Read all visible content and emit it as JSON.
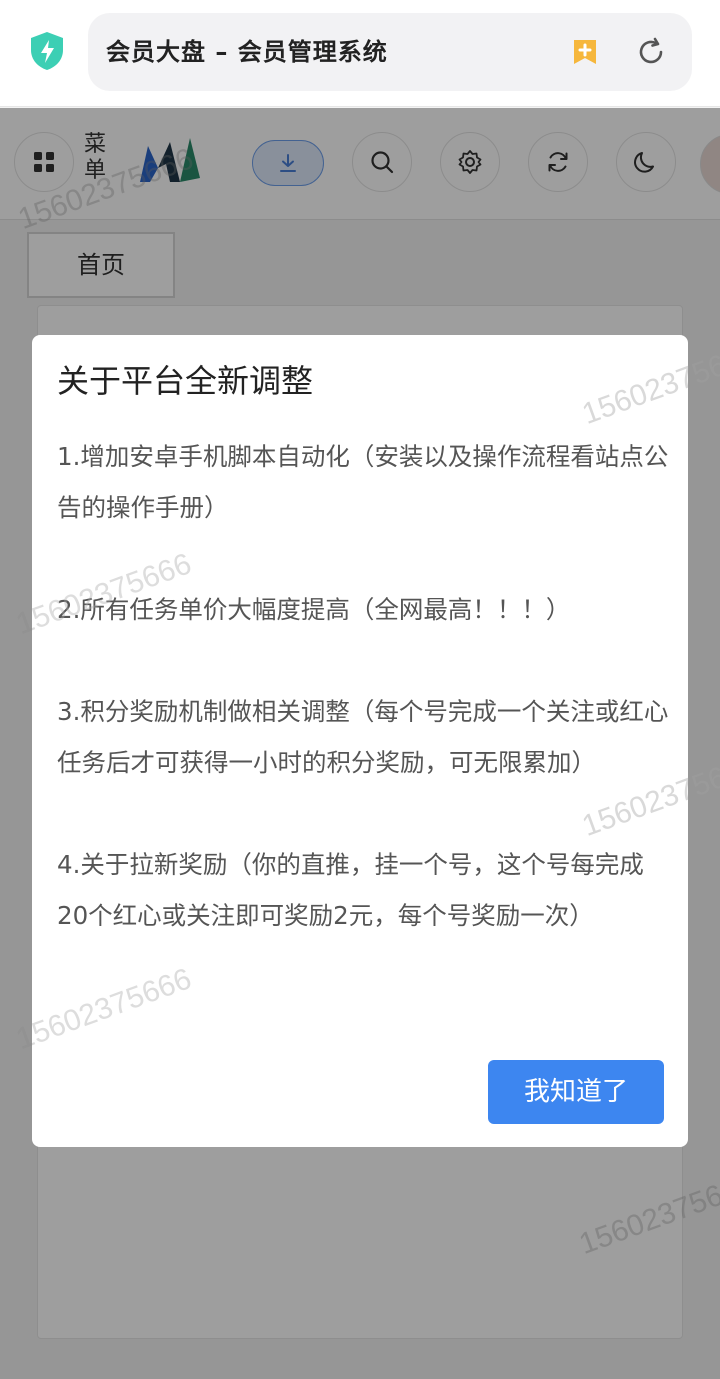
{
  "browser": {
    "address_title": "会员大盘 – 会员管理系统"
  },
  "header": {
    "menu_label": "菜单",
    "tabs": [
      "首页"
    ]
  },
  "dialog": {
    "title": "关于平台全新调整",
    "paragraphs": [
      "1.增加安卓手机脚本自动化（安装以及操作流程看站点公告的操作手册）",
      "2.所有任务单价大幅度提高（全网最高！！！）",
      "3.积分奖励机制做相关调整（每个号完成一个关注或红心任务后才可获得一小时的积分奖励，可无限累加）",
      "4.关于拉新奖励（你的直推，挂一个号，这个号每完成20个红心或关注即可奖励2元，每个号奖励一次）"
    ],
    "ok_label": "我知道了"
  },
  "watermark": "15602375666",
  "colors": {
    "primary": "#3d86f0",
    "shield": "#3ccfb4",
    "bookmark": "#f6b73c"
  }
}
